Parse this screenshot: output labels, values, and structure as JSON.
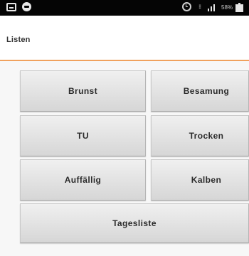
{
  "status_bar": {
    "icons": [
      "screenshot-icon",
      "app-icon",
      "alarm-icon",
      "vibrate-icon",
      "signal-icon",
      "battery-icon"
    ],
    "battery_text": "58%"
  },
  "toolbar": {
    "title": "Listen",
    "accent_color": "#f0a15d"
  },
  "buttons": {
    "brunst": "Brunst",
    "besamung": "Besamung",
    "tu": "TU",
    "trocken": "Trocken",
    "auffaellig": "Auffällig",
    "kalben": "Kalben",
    "tagesliste": "Tagesliste"
  }
}
